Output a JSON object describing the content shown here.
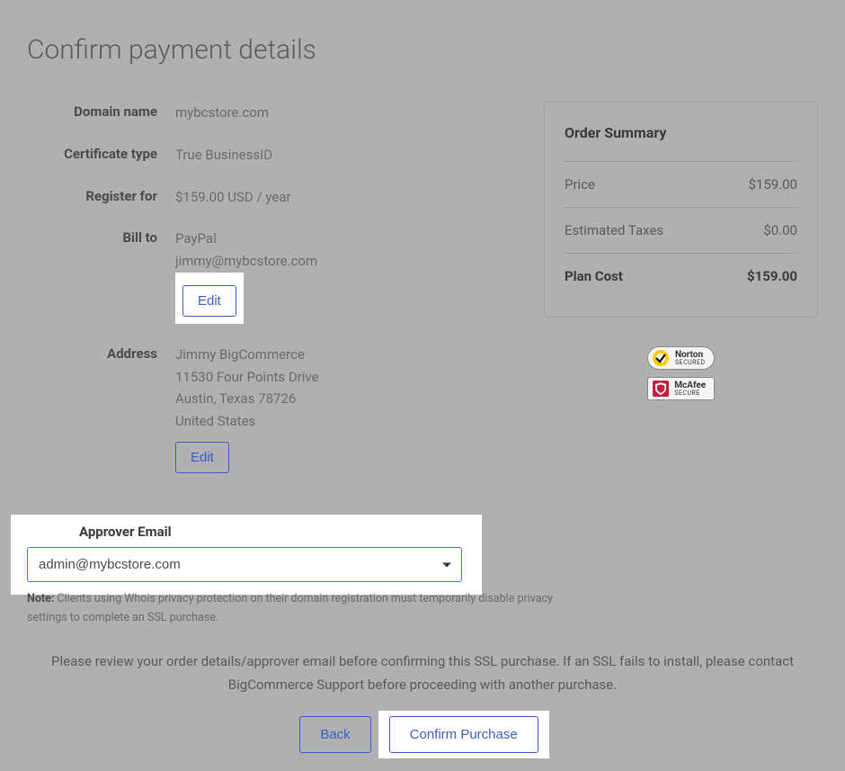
{
  "page": {
    "title": "Confirm payment details"
  },
  "details": {
    "domain_name_label": "Domain name",
    "domain_name_value": "mybcstore.com",
    "certificate_type_label": "Certificate type",
    "certificate_type_value": "True BusinessID",
    "register_for_label": "Register for",
    "register_for_value": "$159.00 USD / year",
    "bill_to_label": "Bill to",
    "bill_to_method": "PayPal",
    "bill_to_email": "jimmy@mybcstore.com",
    "bill_to_edit": "Edit",
    "address_label": "Address",
    "address_name": "Jimmy BigCommerce",
    "address_line1": "11530 Four Points Drive",
    "address_line2": "Austin, Texas 78726",
    "address_country": "United States",
    "address_edit": "Edit"
  },
  "summary": {
    "title": "Order Summary",
    "price_label": "Price",
    "price_value": "$159.00",
    "taxes_label": "Estimated Taxes",
    "taxes_value": "$0.00",
    "total_label": "Plan Cost",
    "total_value": "$159.00"
  },
  "badges": {
    "norton_brand": "Norton",
    "norton_sub": "SECURED",
    "mcafee_brand": "McAfee",
    "mcafee_sub": "SECURE"
  },
  "approver": {
    "label": "Approver Email",
    "selected": "admin@mybcstore.com"
  },
  "note": {
    "prefix": "Note:",
    "text": " Clients using Whois privacy protection on their domain registration must temporarily disable privacy settings to complete an SSL purchase."
  },
  "review_text": "Please review your order details/approver email before confirming this SSL purchase. If an SSL fails to install, please contact BigCommerce Support before proceeding with another purchase.",
  "buttons": {
    "back": "Back",
    "confirm": "Confirm Purchase"
  }
}
